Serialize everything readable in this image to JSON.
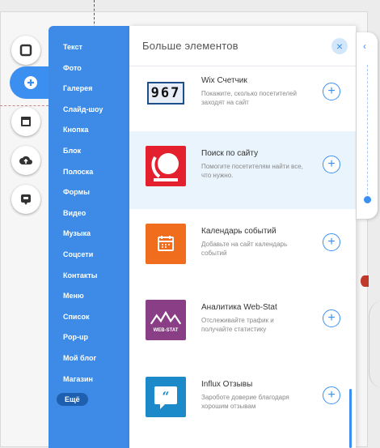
{
  "categories": {
    "items": [
      "Текст",
      "Фото",
      "Галерея",
      "Слайд-шоу",
      "Кнопка",
      "Блок",
      "Полоска",
      "Формы",
      "Видео",
      "Музыка",
      "Соцсети",
      "Контакты",
      "Меню",
      "Список",
      "Pop-up",
      "Мой блог",
      "Магазин",
      "Ещё"
    ],
    "selected": "Ещё"
  },
  "panel": {
    "title": "Больше элементов",
    "close": "×"
  },
  "apps": [
    {
      "name": "Wix Счетчик",
      "desc": "Покажите, сколько посетителей заходят на сайт",
      "counter": "967",
      "add": "+"
    },
    {
      "name": "Поиск по сайту",
      "desc": "Помогите посетителям найти все, что нужно.",
      "add": "+"
    },
    {
      "name": "Календарь событий",
      "desc": "Добавьте на сайт календарь событий",
      "add": "+"
    },
    {
      "name": "Аналитика Web-Stat",
      "desc": "Отслеживайте трафик и получайте статистику",
      "badge": "WEB-STAT",
      "add": "+"
    },
    {
      "name": "Influx Отзывы",
      "desc": "Зароботе доверие благодаря хорошим отзывам",
      "add": "+"
    }
  ],
  "colors": {
    "accent": "#3b8ff0",
    "panel_blue": "#3d8be6"
  }
}
